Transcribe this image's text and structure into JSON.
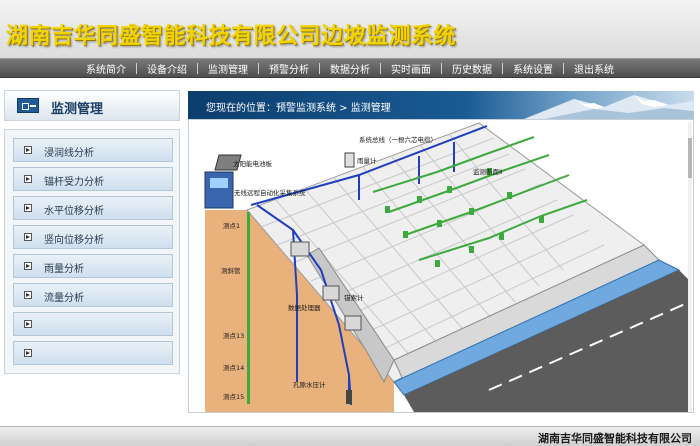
{
  "header": {
    "title": "湖南吉华同盛智能科技有限公司边坡监测系统",
    "title_color": "#f2d400"
  },
  "nav": {
    "items": [
      "系统简介",
      "设备介绍",
      "监测管理",
      "预警分析",
      "数据分析",
      "实时画面",
      "历史数据",
      "系统设置",
      "退出系统"
    ]
  },
  "sidebar": {
    "title": "监测管理",
    "icon": "monitor-panel-icon",
    "items": [
      {
        "label": "浸润线分析"
      },
      {
        "label": "锚杆受力分析"
      },
      {
        "label": "水平位移分析"
      },
      {
        "label": "竖向位移分析"
      },
      {
        "label": "雨量分析"
      },
      {
        "label": "流量分析"
      },
      {
        "label": ""
      },
      {
        "label": ""
      }
    ]
  },
  "content": {
    "breadcrumb": "您现在的位置：预警监测系统 > 监测管理",
    "diagram_labels": {
      "solar": "太阳能电池板",
      "wireless": "无线远程自动化采集系统",
      "main_line": "系统总线（一根六芯电缆）",
      "rain_gauge": "雨量计",
      "section": "监测断面Ⅱ",
      "pipe": "测斜管",
      "anchor": "锚索计",
      "processor": "数据处理器",
      "piezometer": "孔隙水压计",
      "points": [
        "测点1",
        "测点13",
        "测点14",
        "测点15"
      ]
    }
  },
  "footer": {
    "text": "湖南吉华同盛智能科技有限公司"
  },
  "colors": {
    "nav_bg": "#5a5a5a",
    "accent": "#1a5b94",
    "cable_green": "#3daa3d",
    "cable_blue": "#1f3fbf",
    "soil": "#e9b27d"
  }
}
